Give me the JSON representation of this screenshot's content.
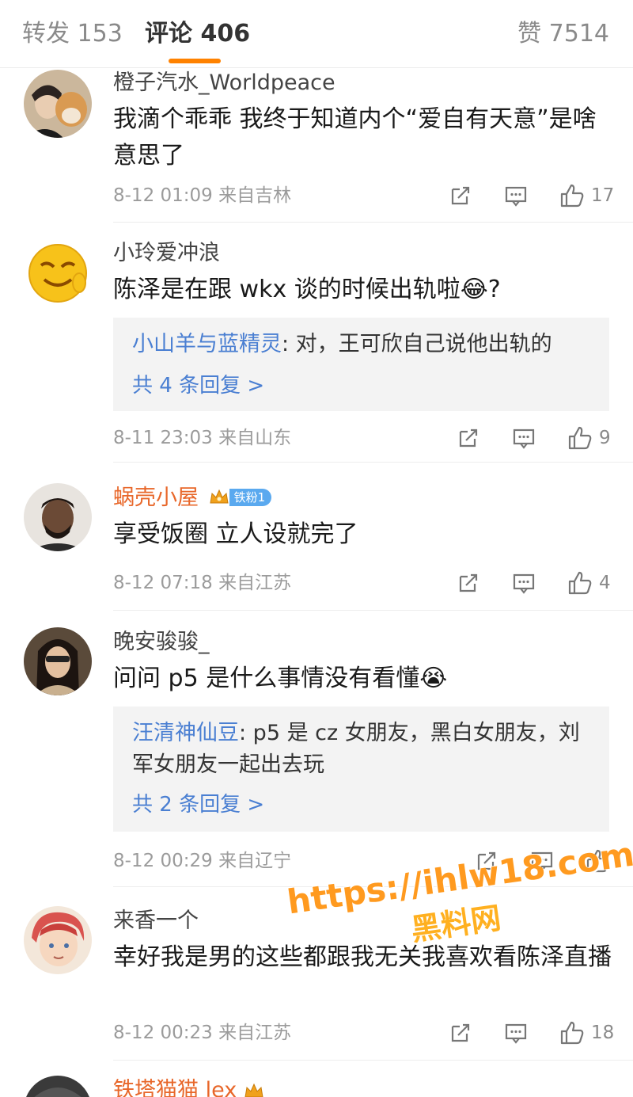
{
  "tabs": {
    "repost": "转发 153",
    "comments": "评论 406",
    "likes": "赞 7514"
  },
  "comments": [
    {
      "user": "橙子汽水_Worldpeace",
      "text": "我滴个乖乖 我终于知道内个“爱自有天意”是啥意思了",
      "meta": "8-12 01:09 来自吉林",
      "likes": "17"
    },
    {
      "user": "小玲爱冲浪",
      "text": "陈泽是在跟 wkx 谈的时候出轨啦😂?",
      "meta": "8-11 23:03 来自山东",
      "likes": "9",
      "reply": {
        "user": "小山羊与蓝精灵",
        "text": ": 对，王可欣自己说他出轨的",
        "more": "共 4 条回复 >"
      }
    },
    {
      "user": "蜗壳小屋",
      "badge": "铁粉1",
      "text": "享受饭圈 立人设就完了",
      "meta": "8-12 07:18 来自江苏",
      "likes": "4"
    },
    {
      "user": "晚安骏骏_",
      "text": "问问 p5 是什么事情没有看懂😭",
      "meta": "8-12 00:29 来自辽宁",
      "likes": "",
      "reply": {
        "user": "汪清神仙豆",
        "text": ": p5 是 cz 女朋友，黑白女朋友，刘军女朋友一起出去玩",
        "more": "共 2 条回复 >"
      }
    },
    {
      "user": "来香一个",
      "text": "幸好我是男的这些都跟我无关我喜欢看陈泽直播",
      "meta": "8-12 00:23 来自江苏",
      "likes": "18"
    },
    {
      "user": "铁塔猫猫 lex"
    }
  ],
  "watermark": {
    "url": "https://ihlw18.com",
    "name": "黑料网"
  },
  "colors": {
    "accent": "#ff8200",
    "link": "#4a7fd2",
    "meta": "#9b9b9b",
    "badge": "#5aa9ef"
  },
  "icons": [
    "share-icon",
    "comment-icon",
    "like-icon",
    "crown-icon"
  ]
}
